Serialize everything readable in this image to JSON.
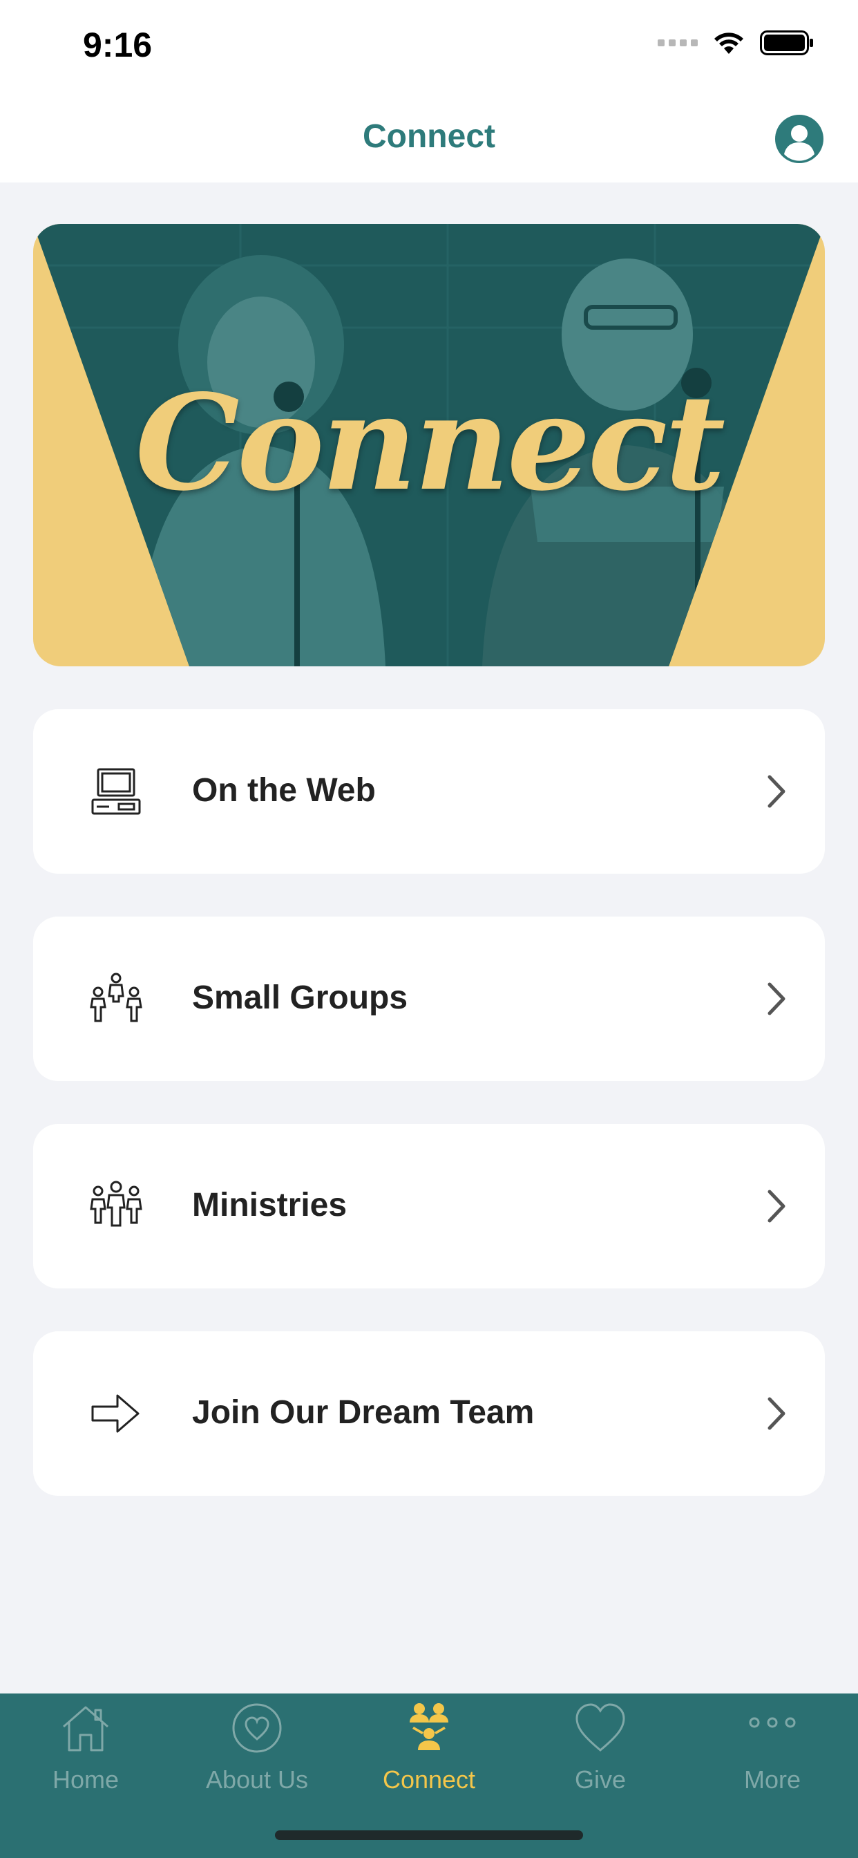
{
  "status_bar": {
    "time": "9:16"
  },
  "nav": {
    "title": "Connect"
  },
  "banner": {
    "title": "Connect"
  },
  "menu": [
    {
      "label": "On the Web",
      "icon": "computer-icon"
    },
    {
      "label": "Small Groups",
      "icon": "small-groups-icon"
    },
    {
      "label": "Ministries",
      "icon": "ministries-icon"
    },
    {
      "label": "Join Our Dream Team",
      "icon": "arrow-right-icon"
    }
  ],
  "tabs": [
    {
      "label": "Home",
      "icon": "home-icon",
      "active": false
    },
    {
      "label": "About Us",
      "icon": "heart-circle-icon",
      "active": false
    },
    {
      "label": "Connect",
      "icon": "people-icon",
      "active": true
    },
    {
      "label": "Give",
      "icon": "heart-icon",
      "active": false
    },
    {
      "label": "More",
      "icon": "more-icon",
      "active": false
    }
  ],
  "colors": {
    "accent": "#2e7b7b",
    "tab_bar": "#2b7072",
    "active_tab": "#f4c64a",
    "banner_gold": "#f0cd7a",
    "banner_teal": "#1f5a5b"
  }
}
